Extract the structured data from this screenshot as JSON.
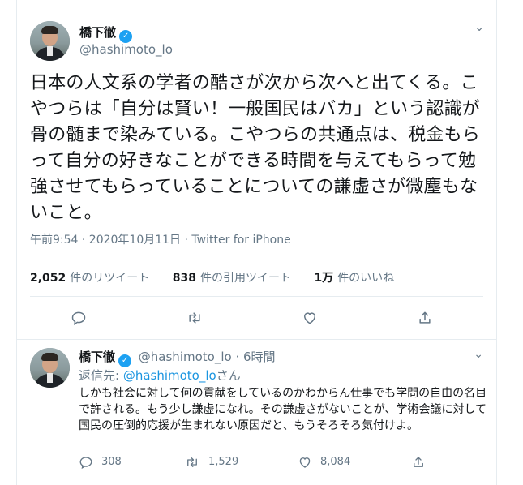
{
  "tweet": {
    "name": "橋下徹",
    "handle": "@hashimoto_lo",
    "text": "日本の人文系の学者の酷さが次から次へと出てくる。こやつらは「自分は賢い！一般国民はバカ」という認識が骨の髄まで染みている。こやつらの共通点は、税金もらって自分の好きなことができる時間を与えてもらって勉強させてもらっていることについての謙虚さが微塵もないこと。",
    "meta": "午前9:54 · 2020年10月11日 · Twitter for iPhone",
    "stats": {
      "retweets_count": "2,052",
      "retweets_label": "件のリツイート",
      "quotes_count": "838",
      "quotes_label": "件の引用ツイート",
      "likes_count": "1万",
      "likes_label": "件のいいね"
    }
  },
  "reply": {
    "name": "橋下徹",
    "handle": "@hashimoto_lo",
    "time": "· 6時間",
    "reply_to_prefix": "返信先: ",
    "reply_to_handle": "@hashimoto_lo",
    "reply_to_suffix": "さん",
    "text": "しかも社会に対して何の貢献をしているのかわからん仕事でも学問の自由の名目で許される。もう少し謙虚になれ。その謙虚さがないことが、学術会議に対して国民の圧倒的応援が生まれない原因だと、もうそろそろ気付けよ。",
    "reply_count": "308",
    "retweet_count": "1,529",
    "like_count": "8,084"
  },
  "icons": {
    "reply": "reply-icon",
    "retweet": "retweet-icon",
    "like": "heart-icon",
    "share": "share-icon",
    "verified": "verified-badge-icon",
    "more": "chevron-down-icon"
  },
  "colors": {
    "link": "#1b95e0",
    "verified": "#1da1f2",
    "secondary_text": "#657786",
    "border": "#e6ecf0"
  }
}
